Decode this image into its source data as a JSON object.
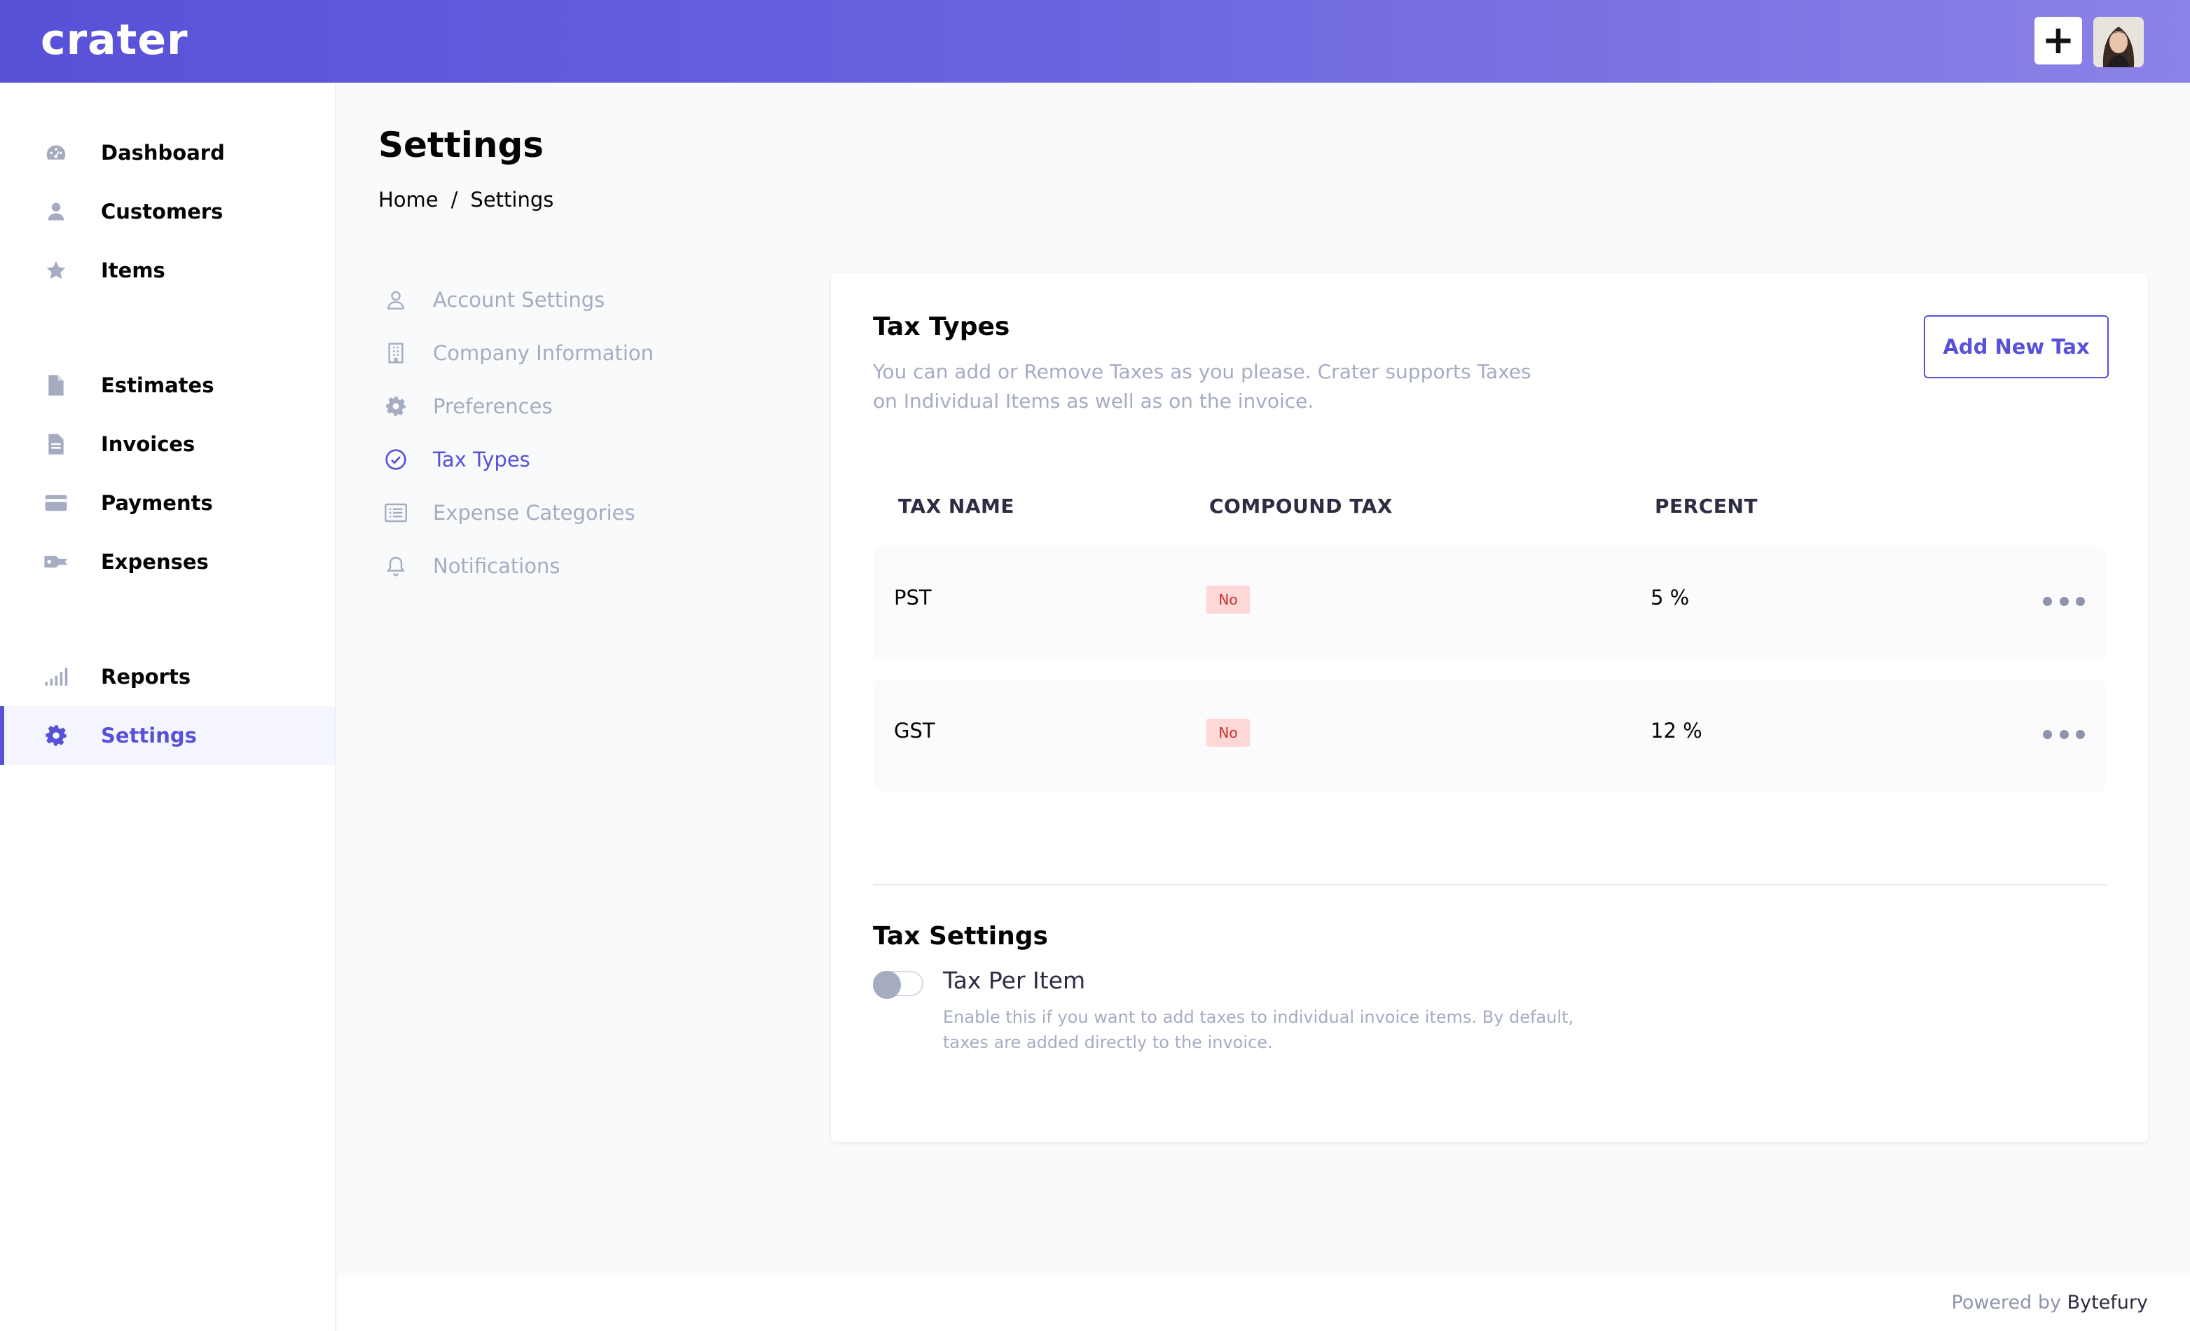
{
  "app": {
    "logo_text": "crater"
  },
  "header": {
    "add_label": "+"
  },
  "sidebar": {
    "items": [
      {
        "label": "Dashboard",
        "icon": "dashboard-icon"
      },
      {
        "label": "Customers",
        "icon": "user-icon"
      },
      {
        "label": "Items",
        "icon": "star-icon"
      },
      {
        "label": "Estimates",
        "icon": "document-icon"
      },
      {
        "label": "Invoices",
        "icon": "document-text-icon"
      },
      {
        "label": "Payments",
        "icon": "credit-card-icon"
      },
      {
        "label": "Expenses",
        "icon": "key-icon"
      },
      {
        "label": "Reports",
        "icon": "signal-bars-icon"
      },
      {
        "label": "Settings",
        "icon": "cog-icon",
        "active": true
      }
    ]
  },
  "page": {
    "title": "Settings",
    "breadcrumb": {
      "home": "Home",
      "separator": "/",
      "current": "Settings"
    }
  },
  "settings_menu": {
    "items": [
      {
        "label": "Account Settings",
        "icon": "user-outline-icon"
      },
      {
        "label": "Company Information",
        "icon": "building-icon"
      },
      {
        "label": "Preferences",
        "icon": "cog-icon"
      },
      {
        "label": "Tax Types",
        "icon": "check-circle-icon",
        "active": true
      },
      {
        "label": "Expense Categories",
        "icon": "list-icon"
      },
      {
        "label": "Notifications",
        "icon": "bell-icon"
      }
    ]
  },
  "tax_types": {
    "title": "Tax Types",
    "description": "You can add or Remove Taxes as you please. Crater supports Taxes on Individual Items as well as on the invoice.",
    "add_button": "Add New Tax",
    "columns": {
      "name": "TAX NAME",
      "compound": "COMPOUND TAX",
      "percent": "PERCENT"
    },
    "rows": [
      {
        "name": "PST",
        "compound": "No",
        "percent": "5 %"
      },
      {
        "name": "GST",
        "compound": "No",
        "percent": "12 %"
      }
    ]
  },
  "tax_settings": {
    "title": "Tax Settings",
    "toggle_label": "Tax Per Item",
    "toggle_on": false,
    "description": "Enable this if you want to add taxes to individual invoice items. By default, taxes are added directly to the invoice."
  },
  "footer": {
    "prefix": "Powered by",
    "brand": "Bytefury"
  },
  "colors": {
    "primary": "#5851d8",
    "badge_bg": "#fed7d7",
    "badge_text": "#c53030",
    "muted": "#a5acc1"
  }
}
